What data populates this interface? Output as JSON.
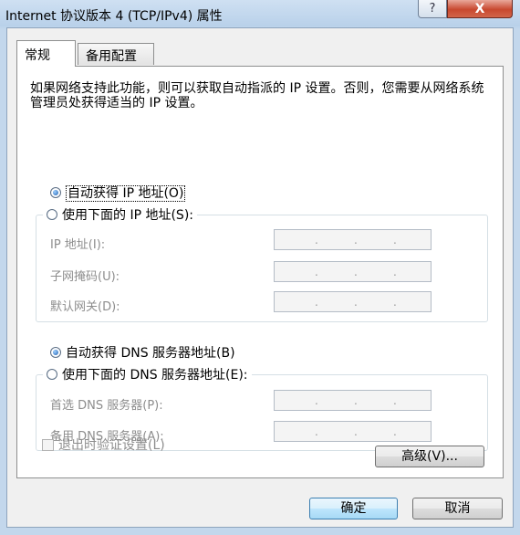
{
  "window": {
    "title": "Internet 协议版本 4 (TCP/IPv4) 属性"
  },
  "titlebar": {
    "help_glyph": "?",
    "close_glyph": "X"
  },
  "tabs": [
    {
      "label": "常规",
      "active": true
    },
    {
      "label": "备用配置",
      "active": false
    }
  ],
  "description": "如果网络支持此功能，则可以获取自动指派的 IP 设置。否则，您需要从网络系统管理员处获得适当的 IP 设置。",
  "ip_section": {
    "auto_radio": {
      "label": "自动获得 IP 地址(O)",
      "selected": true
    },
    "manual_radio": {
      "label": "使用下面的 IP 地址(S):",
      "selected": false
    },
    "fields": [
      {
        "label": "IP 地址(I):",
        "value": ". . ."
      },
      {
        "label": "子网掩码(U):",
        "value": ". . ."
      },
      {
        "label": "默认网关(D):",
        "value": ". . ."
      }
    ]
  },
  "dns_section": {
    "auto_radio": {
      "label": "自动获得 DNS 服务器地址(B)",
      "selected": true
    },
    "manual_radio": {
      "label": "使用下面的 DNS 服务器地址(E):",
      "selected": false
    },
    "fields": [
      {
        "label": "首选 DNS 服务器(P):",
        "value": ". . ."
      },
      {
        "label": "备用 DNS 服务器(A):",
        "value": ". . ."
      }
    ]
  },
  "validate_checkbox": {
    "label": "退出时验证设置(L)",
    "checked": false
  },
  "buttons": {
    "advanced": "高级(V)...",
    "ok": "确定",
    "cancel": "取消"
  }
}
